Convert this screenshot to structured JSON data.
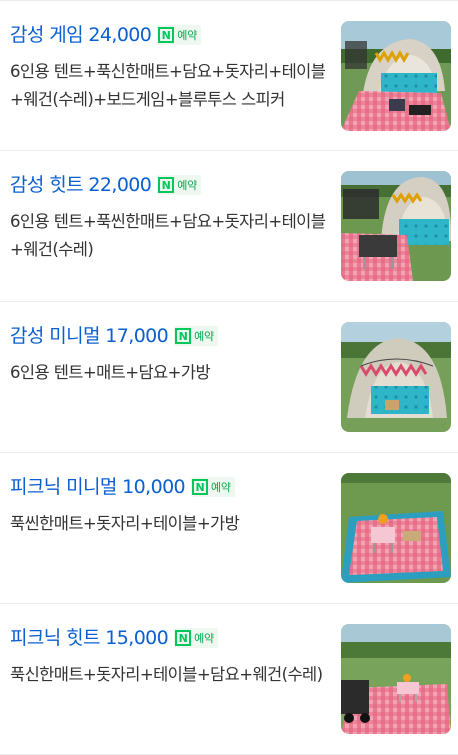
{
  "reservation_badge": {
    "logo": "N",
    "label": "예약"
  },
  "products": [
    {
      "title": "감성 게임 24,000",
      "description": "6인용 텐트+푹신한매트+담요+돗자리+테이블+웨건(수레)+보드게임+블루투스 스피커",
      "thumbnail": "tent-with-blue-mat-and-picnic-blanket-photo"
    },
    {
      "title": "감성 힛트 22,000",
      "description": "6인용 텐트+푹씬한매트+담요+돗자리+테이블+웨건(수레)",
      "thumbnail": "tent-wagon-and-table-photo"
    },
    {
      "title": "감성 미니멀 17,000",
      "description": "6인용 텐트+매트+담요+가방",
      "thumbnail": "tent-with-bunting-photo"
    },
    {
      "title": "피크닉 미니멀 10,000",
      "description": "푹씬한매트+돗자리+테이블+가방",
      "thumbnail": "picnic-mat-on-grass-photo"
    },
    {
      "title": "피크닉 힛트 15,000",
      "description": "푹신한매트+돗자리+테이블+담요+웨건(수레)",
      "thumbnail": "picnic-set-with-wagon-photo"
    }
  ]
}
